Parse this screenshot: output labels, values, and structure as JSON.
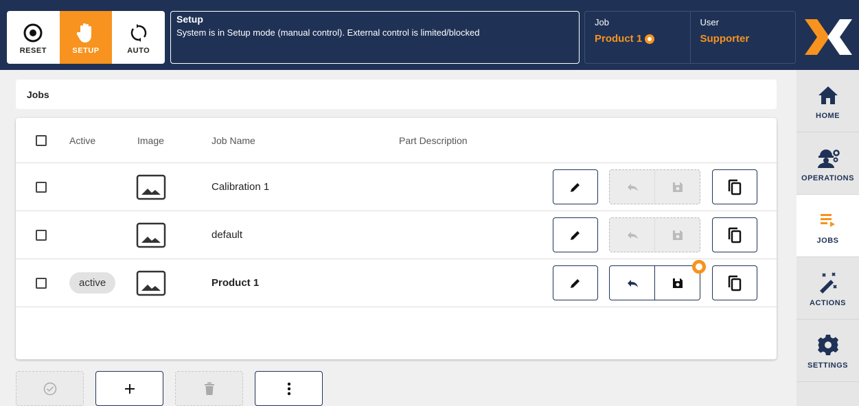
{
  "colors": {
    "navy": "#1f3256",
    "orange": "#f7931e"
  },
  "topbar": {
    "modes": [
      {
        "label": "RESET",
        "icon": "reset-icon"
      },
      {
        "label": "SETUP",
        "icon": "hand-icon",
        "active": true
      },
      {
        "label": "AUTO",
        "icon": "sync-icon"
      }
    ],
    "status": {
      "title": "Setup",
      "message": "System is in Setup mode (manual control). External control is limited/blocked"
    },
    "job": {
      "label": "Job",
      "value": "Product 1"
    },
    "user": {
      "label": "User",
      "value": "Supporter"
    }
  },
  "sidebar": {
    "items": [
      {
        "label": "HOME",
        "icon": "home-icon"
      },
      {
        "label": "OPERATIONS",
        "icon": "operator-icon"
      },
      {
        "label": "JOBS",
        "icon": "jobs-list-icon",
        "active": true
      },
      {
        "label": "ACTIONS",
        "icon": "magic-wand-icon"
      },
      {
        "label": "SETTINGS",
        "icon": "gear-icon"
      }
    ]
  },
  "page": {
    "title": "Jobs"
  },
  "table": {
    "headers": {
      "active": "Active",
      "image": "Image",
      "name": "Job Name",
      "description": "Part Description"
    },
    "rows": [
      {
        "active": "",
        "name": "Calibration 1",
        "description": "",
        "is_active": false,
        "unsaved": false
      },
      {
        "active": "",
        "name": "default",
        "description": "",
        "is_active": false,
        "unsaved": false
      },
      {
        "active": "active",
        "name": "Product 1",
        "description": "",
        "is_active": true,
        "unsaved": true
      }
    ]
  }
}
